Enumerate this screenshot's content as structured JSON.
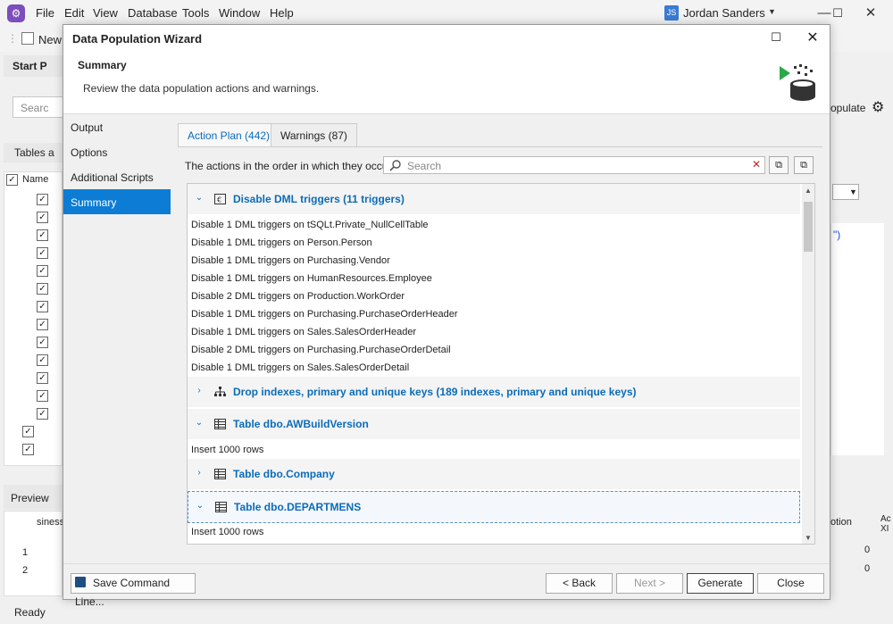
{
  "app": {
    "menu": [
      "File",
      "Edit",
      "View",
      "Database",
      "Tools",
      "Window",
      "Help"
    ],
    "user": {
      "initials": "JS",
      "name": "Jordan Sanders"
    },
    "toolbar_new": "New",
    "bg": {
      "start_tab": "Start P",
      "search_placeholder": "Searc",
      "tables_tab": "Tables a",
      "name_col": "Name",
      "preview_tab": "Preview",
      "business_col": "siness",
      "row_numbers": [
        "1",
        "2"
      ],
      "right_label": "opulate",
      "right_cols": [
        "otion",
        "Ac XI"
      ],
      "right_vals": [
        "0",
        "0"
      ],
      "code_frag": "\")"
    },
    "status": "Ready"
  },
  "dialog": {
    "title": "Data Population Wizard",
    "header_title": "Summary",
    "header_subtitle": "Review the data population actions and warnings.",
    "nav": [
      "Output",
      "Options",
      "Additional Scripts",
      "Summary"
    ],
    "tabs": [
      "Action Plan (442)",
      "Warnings (87)"
    ],
    "description": "The actions in the order in which they occur.",
    "search_placeholder": "Search",
    "groups": [
      {
        "title": "Disable DML triggers (11 triggers)",
        "icon": "trigger-icon",
        "expanded": true,
        "rows": [
          "Disable 1 DML triggers on tSQLt.Private_NullCellTable",
          "Disable 1 DML triggers on Person.Person",
          "Disable 1 DML triggers on Purchasing.Vendor",
          "Disable 1 DML triggers on HumanResources.Employee",
          "Disable 2 DML triggers on Production.WorkOrder",
          "Disable 1 DML triggers on Purchasing.PurchaseOrderHeader",
          "Disable 1 DML triggers on Sales.SalesOrderHeader",
          "Disable 2 DML triggers on Purchasing.PurchaseOrderDetail",
          "Disable 1 DML triggers on Sales.SalesOrderDetail"
        ]
      },
      {
        "title": "Drop indexes, primary and unique keys (189 indexes, primary and unique keys)",
        "icon": "index-tree-icon",
        "expanded": false,
        "rows": []
      },
      {
        "title": "Table dbo.AWBuildVersion",
        "icon": "table-icon",
        "expanded": true,
        "rows": [
          "Insert 1000 rows"
        ]
      },
      {
        "title": "Table dbo.Company",
        "icon": "table-icon",
        "expanded": false,
        "rows": []
      },
      {
        "title": "Table dbo.DEPARTMENS",
        "icon": "table-icon",
        "expanded": true,
        "rows": [
          "Insert 1000 rows"
        ]
      }
    ],
    "buttons": {
      "save_cmd": "Save Command Line...",
      "back": "< Back",
      "next": "Next >",
      "generate": "Generate",
      "close": "Close"
    }
  },
  "colors": {
    "accent": "#0c7cd5",
    "link": "#0c6cb8"
  }
}
